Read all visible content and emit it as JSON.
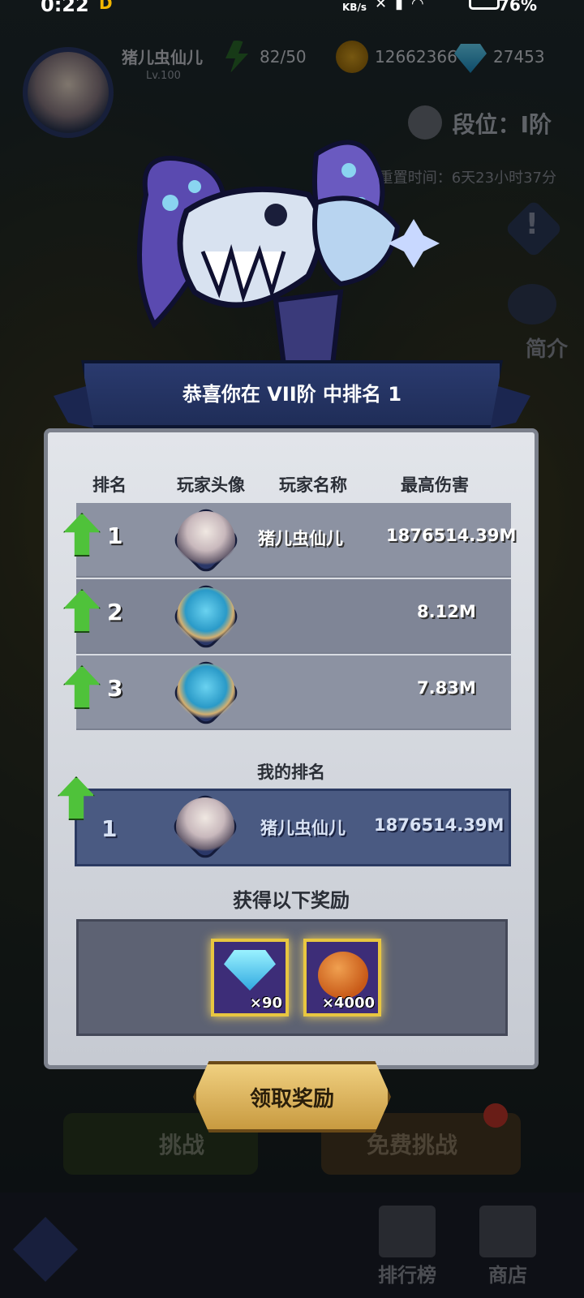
{
  "status_bar": {
    "time": "0:22",
    "carrier_badge": "D",
    "net_speed": "KB/s",
    "battery": "76%"
  },
  "header": {
    "player_name": "猪儿虫仙儿",
    "player_level": "Lv.100",
    "energy": "82/50",
    "coins": "12662366",
    "gems": "27453",
    "tier_label": "段位：I阶",
    "reset_time": "重置时间：6天23小时37分",
    "intro_label": "简介"
  },
  "banner": {
    "title": "恭喜你在 VII阶 中排名 1"
  },
  "table": {
    "headers": [
      "排名",
      "玩家头像",
      "玩家名称",
      "最高伤害"
    ],
    "rows": [
      {
        "rank": "1",
        "name": "猪儿虫仙儿",
        "damage": "1876514.39M",
        "avatar": "girl-avatar"
      },
      {
        "rank": "2",
        "name": "",
        "damage": "8.12M",
        "avatar": "robot-avatar"
      },
      {
        "rank": "3",
        "name": "",
        "damage": "7.83M",
        "avatar": "robot-avatar"
      }
    ]
  },
  "my_rank": {
    "label": "我的排名",
    "rank": "1",
    "name": "猪儿虫仙儿",
    "damage": "1876514.39M"
  },
  "rewards": {
    "label": "获得以下奖励",
    "items": [
      {
        "icon": "diamond-icon",
        "qty": "×90"
      },
      {
        "icon": "pumpkin-icon",
        "qty": "×4000"
      }
    ]
  },
  "buttons": {
    "claim": "领取奖励",
    "challenge": "挑战",
    "free_challenge": "免费挑战"
  },
  "nav": {
    "leaderboard": "排行榜",
    "shop": "商店"
  },
  "colors": {
    "banner": "#2a3a6e",
    "panel": "#d8dce2",
    "row": "#8c92a2",
    "my_row": "#4a5a82",
    "arrow": "#4fc23a",
    "reward_border": "#e8c640",
    "claim_button": "#e0b860"
  }
}
